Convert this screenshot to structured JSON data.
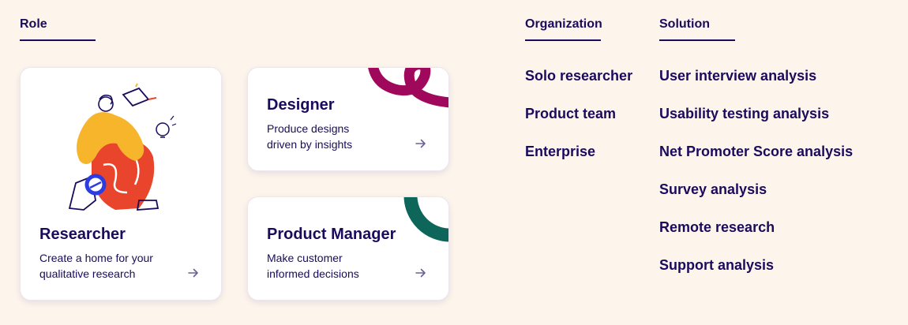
{
  "columns": {
    "role": "Role",
    "organization": "Organization",
    "solution": "Solution"
  },
  "cards": {
    "researcher": {
      "title": "Researcher",
      "desc_line1": "Create a home for your",
      "desc_line2": "qualitative research"
    },
    "designer": {
      "title": "Designer",
      "desc_line1": "Produce designs",
      "desc_line2": "driven by insights"
    },
    "product_manager": {
      "title": "Product Manager",
      "desc_line1": "Make customer",
      "desc_line2": "informed decisions"
    }
  },
  "organization_links": [
    "Solo researcher",
    "Product team",
    "Enterprise"
  ],
  "solution_links": [
    "User interview analysis",
    "Usability testing analysis",
    "Net Promoter Score analysis",
    "Survey analysis",
    "Remote research",
    "Support analysis"
  ],
  "colors": {
    "background": "#fdf5ec",
    "text": "#1a0b5c",
    "designer_accent": "#a0085c",
    "pm_accent": "#0d6659",
    "illustration_orange": "#f7b52c",
    "illustration_red": "#e8452c",
    "illustration_blue": "#2c3ce0"
  },
  "icons": [
    "arrow-right-icon",
    "researcher-illustration"
  ]
}
